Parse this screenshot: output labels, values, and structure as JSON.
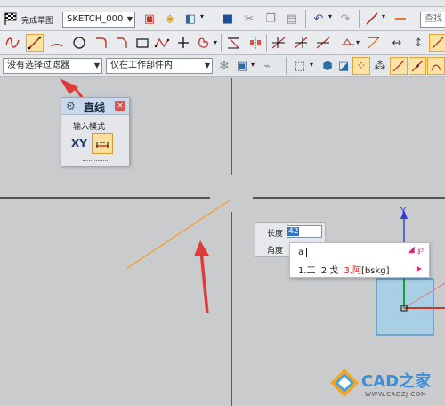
{
  "toolbar1": {
    "finish_sketch_label": "完成草图",
    "sketch_name": "SKETCH_000",
    "search_placeholder": "查找"
  },
  "toolbar3": {
    "filter_value": "没有选择过滤器",
    "scope_value": "仅在工作部件内"
  },
  "dialog": {
    "title": "直线",
    "input_mode_label": "输入模式",
    "xy_label": "XY"
  },
  "entry": {
    "length_label": "长度",
    "length_value": "42",
    "angle_label": "角度"
  },
  "ime": {
    "composition": "a",
    "candidates": [
      {
        "num": "1.",
        "text": "工"
      },
      {
        "num": "2.",
        "text": "戈"
      },
      {
        "num": "3.",
        "text": "阿"
      }
    ],
    "code_hint": "[bskg]"
  },
  "axis": {
    "y_label": "Y"
  },
  "watermark": {
    "site": "CAD之家",
    "url": "WWW.CADZJ.COM"
  },
  "colors": {
    "line": "#f0a040",
    "arrow": "#e04040",
    "accent": "#ff7f00"
  }
}
